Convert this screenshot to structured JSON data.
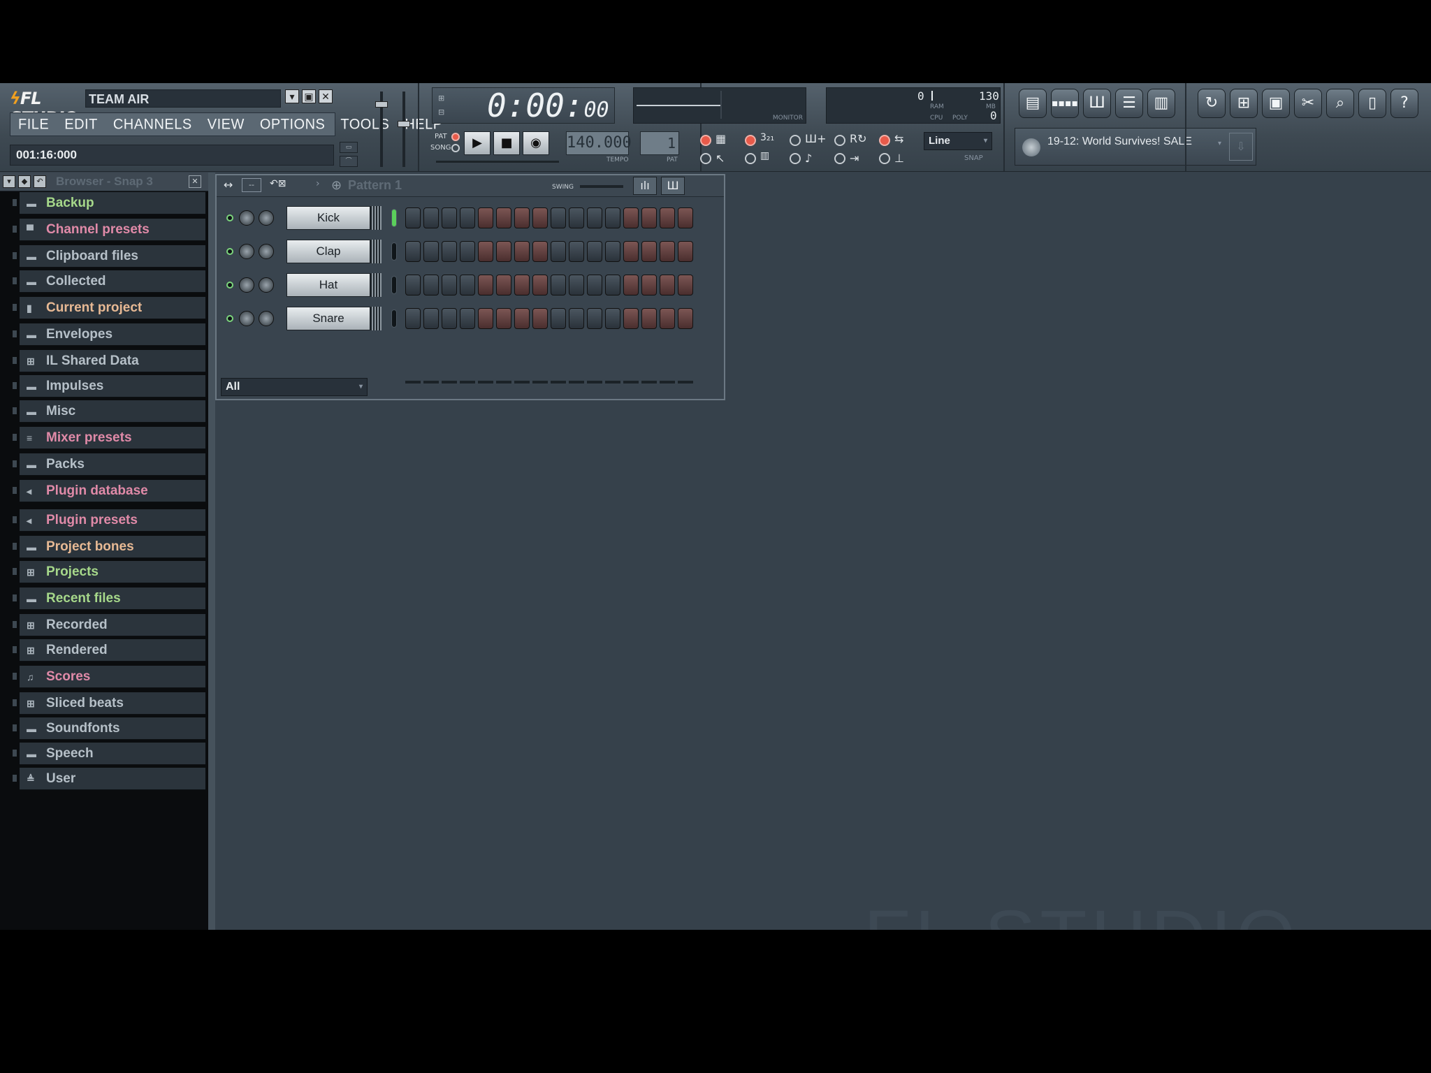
{
  "app": {
    "logo": "FL STUDIO",
    "registered_user": "TEAM AIR",
    "window_buttons": [
      "▾",
      "▣",
      "✕"
    ]
  },
  "menu": [
    "FILE",
    "EDIT",
    "CHANNELS",
    "VIEW",
    "OPTIONS",
    "TOOLS",
    "HELP"
  ],
  "hint_bar": "001:16:000",
  "transport": {
    "time": "0:00:",
    "time_small": "00",
    "pat_label": "PAT",
    "song_label": "SONG",
    "tempo": "140.000",
    "tempo_label": "TEMPO",
    "pattern_number": "1",
    "pattern_label": "PAT"
  },
  "monitor": {
    "label": "MONITOR"
  },
  "cpu": {
    "ram_label": "RAM",
    "cpu_label": "CPU",
    "poly_label": "POLY",
    "mb_label": "MB",
    "value1": "0",
    "value2": "130",
    "poly_value": "0"
  },
  "snap": {
    "value": "Line",
    "label": "SNAP"
  },
  "news": {
    "text": "19-12: World Survives! SALE"
  },
  "toolbar_icons": [
    "playlist-icon",
    "step-sequencer-icon",
    "piano-roll-icon",
    "browser-icon",
    "mixer-icon",
    "undo-icon",
    "save-icon",
    "render-icon",
    "cut-icon",
    "zoom-icon",
    "info-icon",
    "help-icon"
  ],
  "browser": {
    "title": "Browser - Snap 3",
    "items": [
      {
        "label": "Backup",
        "color": "#a6d88a",
        "icon": "folder-icon"
      },
      {
        "label": "Channel presets",
        "color": "#e08aa8",
        "icon": "channel-icon"
      },
      {
        "label": "Clipboard files",
        "color": "#b6c0c8",
        "icon": "folder-icon"
      },
      {
        "label": "Collected",
        "color": "#b6c0c8",
        "icon": "folder-icon"
      },
      {
        "label": "Current project",
        "color": "#e7b994",
        "icon": "project-icon"
      },
      {
        "label": "Envelopes",
        "color": "#b6c0c8",
        "icon": "folder-icon"
      },
      {
        "label": "IL Shared Data",
        "color": "#b6c0c8",
        "icon": "tree-icon"
      },
      {
        "label": "Impulses",
        "color": "#b6c0c8",
        "icon": "folder-icon"
      },
      {
        "label": "Misc",
        "color": "#b6c0c8",
        "icon": "folder-icon"
      },
      {
        "label": "Mixer presets",
        "color": "#e08aa8",
        "icon": "mixer-icon"
      },
      {
        "label": "Packs",
        "color": "#b6c0c8",
        "icon": "folder-icon"
      },
      {
        "label": "Plugin database",
        "color": "#e08aa8",
        "icon": "plugin-icon"
      },
      {
        "label": "Plugin presets",
        "color": "#e08aa8",
        "icon": "plugin-icon"
      },
      {
        "label": "Project bones",
        "color": "#e7b994",
        "icon": "folder-icon"
      },
      {
        "label": "Projects",
        "color": "#a6d88a",
        "icon": "tree-icon"
      },
      {
        "label": "Recent files",
        "color": "#a6d88a",
        "icon": "folder-icon"
      },
      {
        "label": "Recorded",
        "color": "#b6c0c8",
        "icon": "tree-icon"
      },
      {
        "label": "Rendered",
        "color": "#b6c0c8",
        "icon": "tree-icon"
      },
      {
        "label": "Scores",
        "color": "#e08aa8",
        "icon": "note-icon"
      },
      {
        "label": "Sliced beats",
        "color": "#b6c0c8",
        "icon": "tree-icon"
      },
      {
        "label": "Soundfonts",
        "color": "#b6c0c8",
        "icon": "folder-icon"
      },
      {
        "label": "Speech",
        "color": "#b6c0c8",
        "icon": "folder-icon"
      },
      {
        "label": "User",
        "color": "#b6c0c8",
        "icon": "user-icon"
      }
    ]
  },
  "channel_rack": {
    "pattern": "Pattern 1",
    "swing_label": "SWING",
    "channels": [
      {
        "name": "Kick",
        "selected": true
      },
      {
        "name": "Clap",
        "selected": false
      },
      {
        "name": "Hat",
        "selected": false
      },
      {
        "name": "Snare",
        "selected": false
      }
    ],
    "filter": "All"
  },
  "workspace_watermark": "FL STUDIO",
  "colors": {
    "accent_record": "#e85a4a",
    "led_green": "#7dd67d",
    "workspace": "#36414b"
  }
}
